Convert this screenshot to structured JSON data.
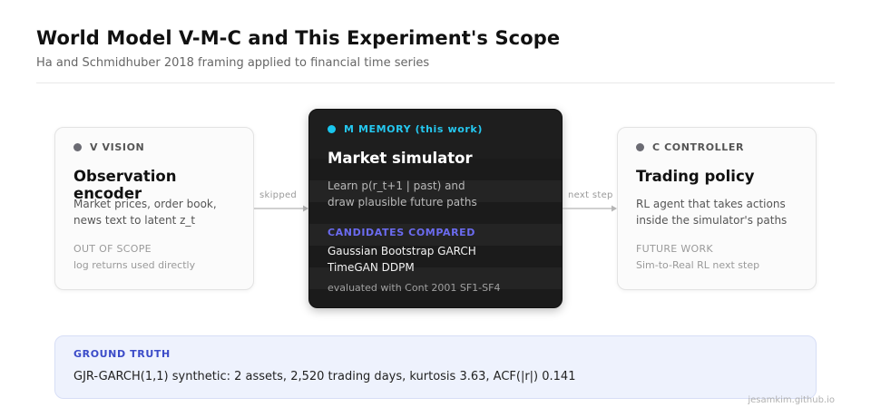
{
  "header": {
    "title": "World Model V-M-C and This Experiment's Scope",
    "subtitle": "Ha and Schmidhuber 2018 framing applied to financial time series"
  },
  "colors": {
    "accent_cyan": "#19c6ee",
    "candidates_purple": "#6b6bf0",
    "ground_truth_blue": "#3b4bc8",
    "dark_card": "#1e1e1e"
  },
  "cards": {
    "vision": {
      "tag": "V VISION",
      "heading": "Observation encoder",
      "desc_line1": "Market prices, order book,",
      "desc_line2": "news text to latent z_t",
      "note_label": "OUT OF SCOPE",
      "note_text": "log returns used directly"
    },
    "memory": {
      "tag": "M MEMORY (this work)",
      "heading": "Market simulator",
      "desc_line1": "Learn p(r_t+1 | past) and",
      "desc_line2": "draw plausible future paths",
      "candidates_label": "CANDIDATES COMPARED",
      "candidates_line1": "Gaussian Bootstrap GARCH",
      "candidates_line2": "TimeGAN DDPM",
      "eval_note": "evaluated with Cont 2001 SF1-SF4"
    },
    "controller": {
      "tag": "C CONTROLLER",
      "heading": "Trading policy",
      "desc_line1": "RL agent that takes actions",
      "desc_line2": "inside the simulator's paths",
      "note_label": "FUTURE WORK",
      "note_text": "Sim-to-Real RL next step"
    }
  },
  "connectors": {
    "v_to_m": "skipped",
    "m_to_c": "next step"
  },
  "ground_truth": {
    "label": "GROUND TRUTH",
    "text": "GJR-GARCH(1,1) synthetic: 2 assets, 2,520 trading days, kurtosis 3.63, ACF(|r|) 0.141"
  },
  "footer": {
    "credit": "jesamkim.github.io"
  }
}
